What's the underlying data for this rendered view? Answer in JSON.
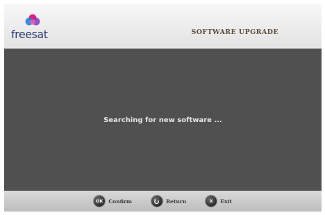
{
  "header": {
    "logo_text": "freesat",
    "title": "SOFTWARE UPGRADE"
  },
  "main": {
    "status_text": "Searching for new software ..."
  },
  "footer": {
    "keys": [
      {
        "glyph": "OK",
        "label": "Confirm",
        "icon": "ok-button-icon"
      },
      {
        "glyph": "",
        "label": "Return",
        "icon": "return-arrow-icon"
      },
      {
        "glyph": "X",
        "label": "Exit",
        "icon": "exit-x-icon"
      }
    ]
  },
  "colors": {
    "content_background": "#505050",
    "header_background": "#eeeeee",
    "logo_text": "#2f3e73"
  }
}
